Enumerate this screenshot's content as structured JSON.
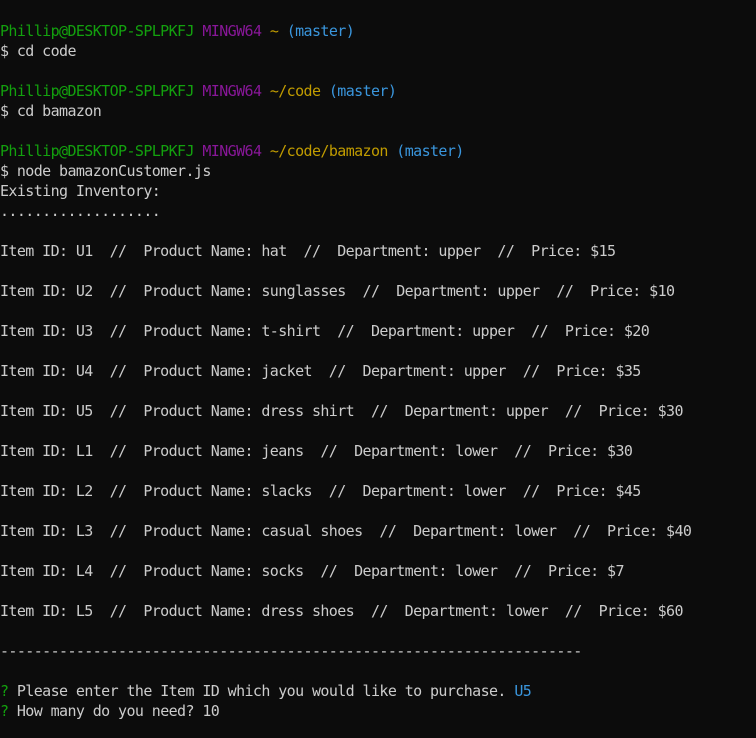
{
  "terminal": {
    "prompts": [
      {
        "user_host": "Phillip@DESKTOP-SPLPKFJ",
        "env": "MINGW64",
        "path": "~",
        "branch": "(master)",
        "command": "$ cd code"
      },
      {
        "user_host": "Phillip@DESKTOP-SPLPKFJ",
        "env": "MINGW64",
        "path": "~/code",
        "branch": "(master)",
        "command": "$ cd bamazon"
      },
      {
        "user_host": "Phillip@DESKTOP-SPLPKFJ",
        "env": "MINGW64",
        "path": "~/code/bamazon",
        "branch": "(master)",
        "command": "$ node bamazonCustomer.js"
      }
    ],
    "inventory_header": "Existing Inventory:",
    "dots": "...................",
    "items": [
      "Item ID: U1  //  Product Name: hat  //  Department: upper  //  Price: $15",
      "Item ID: U2  //  Product Name: sunglasses  //  Department: upper  //  Price: $10",
      "Item ID: U3  //  Product Name: t-shirt  //  Department: upper  //  Price: $20",
      "Item ID: U4  //  Product Name: jacket  //  Department: upper  //  Price: $35",
      "Item ID: U5  //  Product Name: dress shirt  //  Department: upper  //  Price: $30",
      "Item ID: L1  //  Product Name: jeans  //  Department: lower  //  Price: $30",
      "Item ID: L2  //  Product Name: slacks  //  Department: lower  //  Price: $45",
      "Item ID: L3  //  Product Name: casual shoes  //  Department: lower  //  Price: $40",
      "Item ID: L4  //  Product Name: socks  //  Department: lower  //  Price: $7",
      "Item ID: L5  //  Product Name: dress shoes  //  Department: lower  //  Price: $60"
    ],
    "separator": "---------------------------------------------------------------------",
    "questions": [
      {
        "mark": "?",
        "text": "Please enter the Item ID which you would like to purchase.",
        "answer": "U5"
      },
      {
        "mark": "?",
        "text": "How many do you need?",
        "answer": "10"
      }
    ]
  },
  "colors": {
    "background": "#0c0c0c",
    "text": "#cccccc",
    "user_host": "#13a10e",
    "env": "#881798",
    "path": "#c19c00",
    "branch": "#3a96dd",
    "question_mark": "#13a10e",
    "answer_u5": "#3a96dd"
  }
}
